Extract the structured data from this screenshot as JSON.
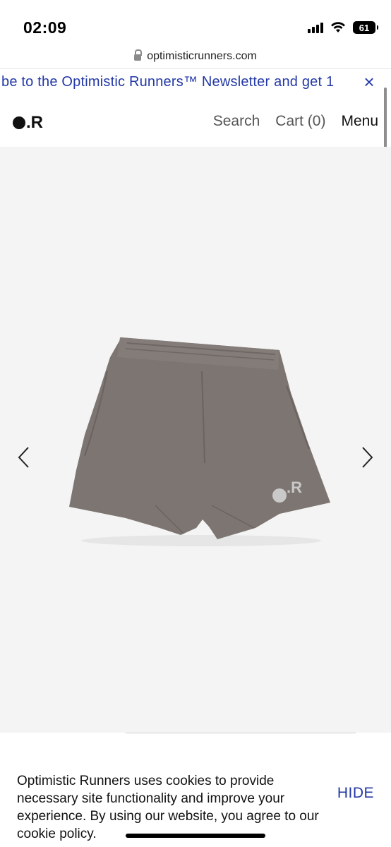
{
  "status_bar": {
    "time": "02:09",
    "battery": "61",
    "icons": [
      "cellular-signal-icon",
      "wifi-icon",
      "battery-icon"
    ]
  },
  "browser": {
    "url": "optimisticrunners.com"
  },
  "announcement": {
    "text": "be to the Optimistic Runners™ Newsletter and get 1",
    "close_label": "×"
  },
  "header": {
    "logo_text": ".R",
    "nav": {
      "search": "Search",
      "cart": "Cart (0)",
      "menu": "Menu"
    }
  },
  "product_gallery": {
    "image_logo_text": ".R",
    "prev_icon": "chevron-left-icon",
    "next_icon": "chevron-right-icon"
  },
  "cookie_banner": {
    "message": "Optimistic Runners uses cookies to provide necessary site functionality and improve your experience. By using our website, you agree to our cookie policy.",
    "hide_label": "HIDE"
  },
  "colors": {
    "accent_blue": "#2338a6",
    "gallery_bg": "#f4f4f4",
    "shorts_gray": "#7d7571"
  }
}
